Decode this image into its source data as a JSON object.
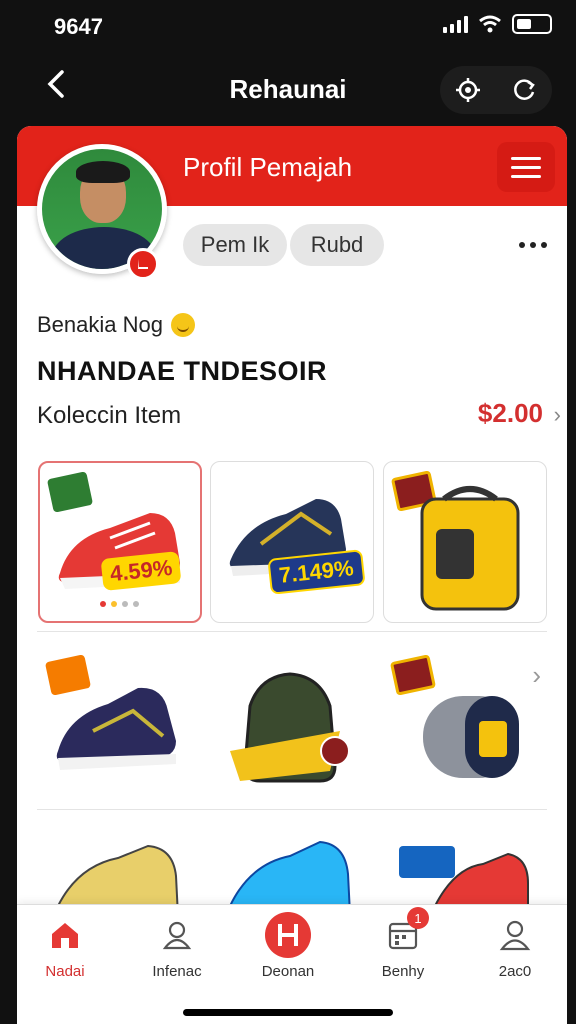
{
  "status_bar": {
    "time": "9647"
  },
  "nav": {
    "title": "Rehaunai"
  },
  "profile": {
    "header_title": "Profil Pemajah",
    "chips": [
      "Pem Ik",
      "Rubd"
    ],
    "greeting": "Benakia Nog",
    "player_name": "NHANDAE TNDESOIR",
    "collection_label": "Koleccin Item",
    "collection_price": "$2.00"
  },
  "items": [
    {
      "discount": "4.59%",
      "name": "red-sneaker"
    },
    {
      "discount": "7.149%",
      "name": "navy-sneaker"
    },
    {
      "discount": "",
      "name": "yellow-case"
    },
    {
      "discount": "",
      "name": "navy-cleat"
    },
    {
      "discount": "",
      "name": "green-backpack"
    },
    {
      "discount": "",
      "name": "grey-canister"
    },
    {
      "discount": "",
      "name": "yellow-shoe"
    },
    {
      "discount": "",
      "name": "blue-shoe"
    },
    {
      "discount": "",
      "name": "red-shoe"
    }
  ],
  "bottom_nav": {
    "items": [
      {
        "label": "Nadai",
        "icon": "home-icon",
        "active": true
      },
      {
        "label": "Infenac",
        "icon": "person-card-icon"
      },
      {
        "label": "Deonan",
        "icon": "h-circle-icon"
      },
      {
        "label": "Benhy",
        "icon": "calendar-icon",
        "badge": "1"
      },
      {
        "label": "2ac0",
        "icon": "profile-icon"
      }
    ]
  },
  "colors": {
    "accent": "#e2231a",
    "price": "#d32f2f"
  }
}
